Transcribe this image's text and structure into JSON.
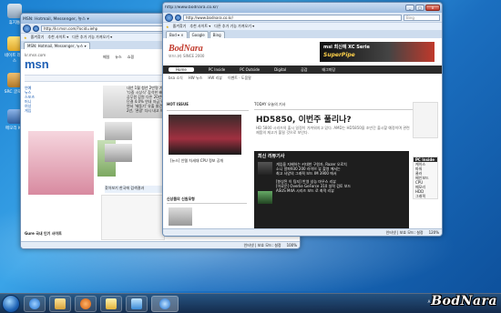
{
  "desktop": {
    "icons": [
      {
        "label": "휴지통",
        "color": "#9fb4c8"
      },
      {
        "label": "네이트 레이스",
        "color": "#f2c94c"
      },
      {
        "label": "SRC 글로벌",
        "color": "#d4a24a"
      },
      {
        "label": "메모리 KB",
        "color": "#4f7fc4"
      }
    ]
  },
  "left_window": {
    "address": "http://kr.msn.com/?ocid=iehp",
    "search_placeholder": "Bing",
    "fav_items": [
      "즐겨찾기",
      "추천 사이트 ▾",
      "다른 추가 기능 가져오기 ▾"
    ],
    "tab_label": "MSN: Hotmail, Messenger, 뉴스 ▾",
    "brand": "msn",
    "site": "kr.msn.com",
    "menu": [
      "메일",
      "뉴스",
      "쇼핑"
    ],
    "nav_items": [
      "연예",
      "뉴스",
      "스포츠",
      "머니",
      "여성",
      "게임"
    ],
    "subnav": [
      "인기검색어",
      "성행전",
      "대학거능으로",
      "서울"
    ],
    "headlines": [
      "내년 1월 청년 2만명 기업 인턴 채용",
      "'다중 시상식' 참석한 배우 이야기",
      "공무원 감원 다른 20년만에 처음",
      "단결 4.0% 연내 자금 약 80여억원 보장",
      "연서 '제동기' 유출 물건 수습한 것",
      "2년, '관광' 다시 내고 아이돌 공연"
    ],
    "promo": "찾아보기 한국에 검색결과",
    "footer": "Gure 국내 인기 사이트",
    "status": "인터넷 | 보호 모드: 설정",
    "zoom": "100%"
  },
  "right_window": {
    "address": "http://www.bodnara.co.kr/",
    "search_placeholder": "Bing",
    "fav_items": [
      "즐겨찾기",
      "추천 사이트 ▾",
      "다른 추가 기능 가져오기 ▾"
    ],
    "tabs": [
      "Bod ▾ ×",
      "Google",
      "Bing"
    ],
    "site_logo": "BodNara",
    "site_tagline": "보드나라 SINCE 2000",
    "site_nav": [
      "Home",
      "PC Inside",
      "PC Outside",
      "Digital",
      "공감",
      "태그마당"
    ],
    "banner_title": "msi 최신예 XC Serie",
    "banner_sub": "SuperPipe",
    "subnav": [
      "bsa 소식",
      "HW 뉴스",
      "HW 리뷰",
      "이벤트 · 도움말"
    ],
    "hot_issue_label": "HOT ISSUE",
    "today_label": "TODAY 오늘의 기사",
    "headline": "HD5850, 이번주 풀리나?",
    "headline_body": "HD 5800 시리즈의 출시 일정이 가까워지고 있다. AMD는 HD5850을 조만간 출시할 예정이며 관련 제품의 재고가 풀릴 것으로 보인다.",
    "hot_caption": "[뉴스] 인텔 차세대 CPU 정보 공개",
    "review_header": "최신 리뷰기사",
    "review_items": [
      "게임을 지배하는 커대한 구원자, Razer 오로치",
      "소니 알파930 200 라이브 뷰 촬영 에서는",
      "최고 사양의 그래픽 보드 IM 3900 에서",
      "[향상된 이 팀지] 반영 성능 마우스 리뷰",
      "[이료운] Overlie GeForce 310 실력 검토 보드",
      "ASUS M4A 시리즈 보드 로 최적 리뷰"
    ],
    "sidebar_label": "PC Inside",
    "sidebar_items": [
      "케이스",
      "파워",
      "쿨러",
      "메인보드",
      "CPU",
      "메모리",
      "HDD",
      "그래픽"
    ],
    "side_box_title": "신상품의 신원모형",
    "status": "인터넷 | 보호 모드: 설정",
    "zoom": "120%"
  },
  "taskbar": {
    "items": [
      "ie",
      "explorer",
      "media",
      "folder",
      "paint",
      "ie-active"
    ],
    "tray": [
      "A",
      "가"
    ],
    "watermark": "BodNara"
  },
  "colors": {
    "desktop_bg": "#1f7fd0",
    "accent_red": "#c0392b",
    "msn_blue": "#1e5fb4",
    "bodnara_dark": "#2a2a2a"
  }
}
